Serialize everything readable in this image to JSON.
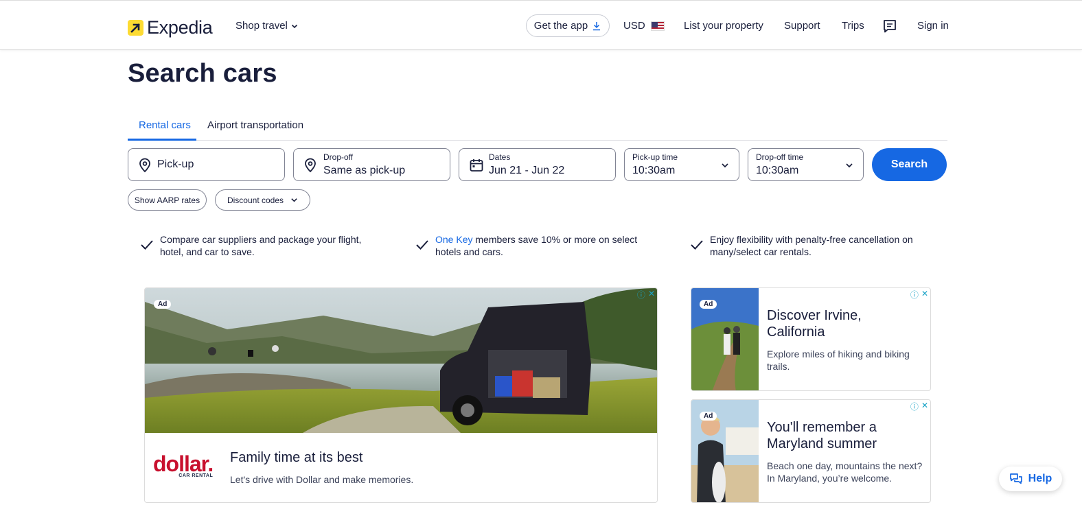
{
  "header": {
    "logo_text": "Expedia",
    "shop_travel": "Shop travel",
    "get_app": "Get the app",
    "currency": "USD",
    "list_property": "List your property",
    "support": "Support",
    "trips": "Trips",
    "sign_in": "Sign in"
  },
  "page_title": "Search cars",
  "tabs": [
    {
      "label": "Rental cars",
      "active": true
    },
    {
      "label": "Airport transportation",
      "active": false
    }
  ],
  "search": {
    "pickup_placeholder": "Pick-up",
    "dropoff_label": "Drop-off",
    "dropoff_value": "Same as pick-up",
    "dates_label": "Dates",
    "dates_value": "Jun 21 - Jun 22",
    "pickup_time_label": "Pick-up time",
    "pickup_time_value": "10:30am",
    "dropoff_time_label": "Drop-off time",
    "dropoff_time_value": "10:30am",
    "search_button": "Search"
  },
  "pills": {
    "aarp": "Show AARP rates",
    "discount": "Discount codes"
  },
  "benefits": [
    {
      "pre": "",
      "link": "",
      "text": "Compare car suppliers and package your flight, hotel, and car to save."
    },
    {
      "pre": "",
      "link": "One Key",
      "text": " members save 10% or more on select hotels and cars."
    },
    {
      "pre": "",
      "link": "",
      "text": "Enjoy flexibility with penalty-free cancellation on many/select car rentals."
    }
  ],
  "ads": {
    "badge": "Ad",
    "main": {
      "brand_word": "dollar.",
      "brand_sub": "CAR RENTAL",
      "headline": "Family time at its best",
      "sub": "Let's drive with Dollar and make memories."
    },
    "side": [
      {
        "headline": "Discover Irvine, California",
        "sub": "Explore miles of hiking and biking trails."
      },
      {
        "headline": "You'll remember a Maryland summer",
        "sub": "Beach one day, mountains the next? In Maryland, you’re welcome."
      }
    ]
  },
  "help_button": "Help",
  "colors": {
    "accent": "#1668e3",
    "brand_yellow": "#fddb32",
    "text_dark": "#191e3b",
    "dollar_red": "#c8102e"
  }
}
